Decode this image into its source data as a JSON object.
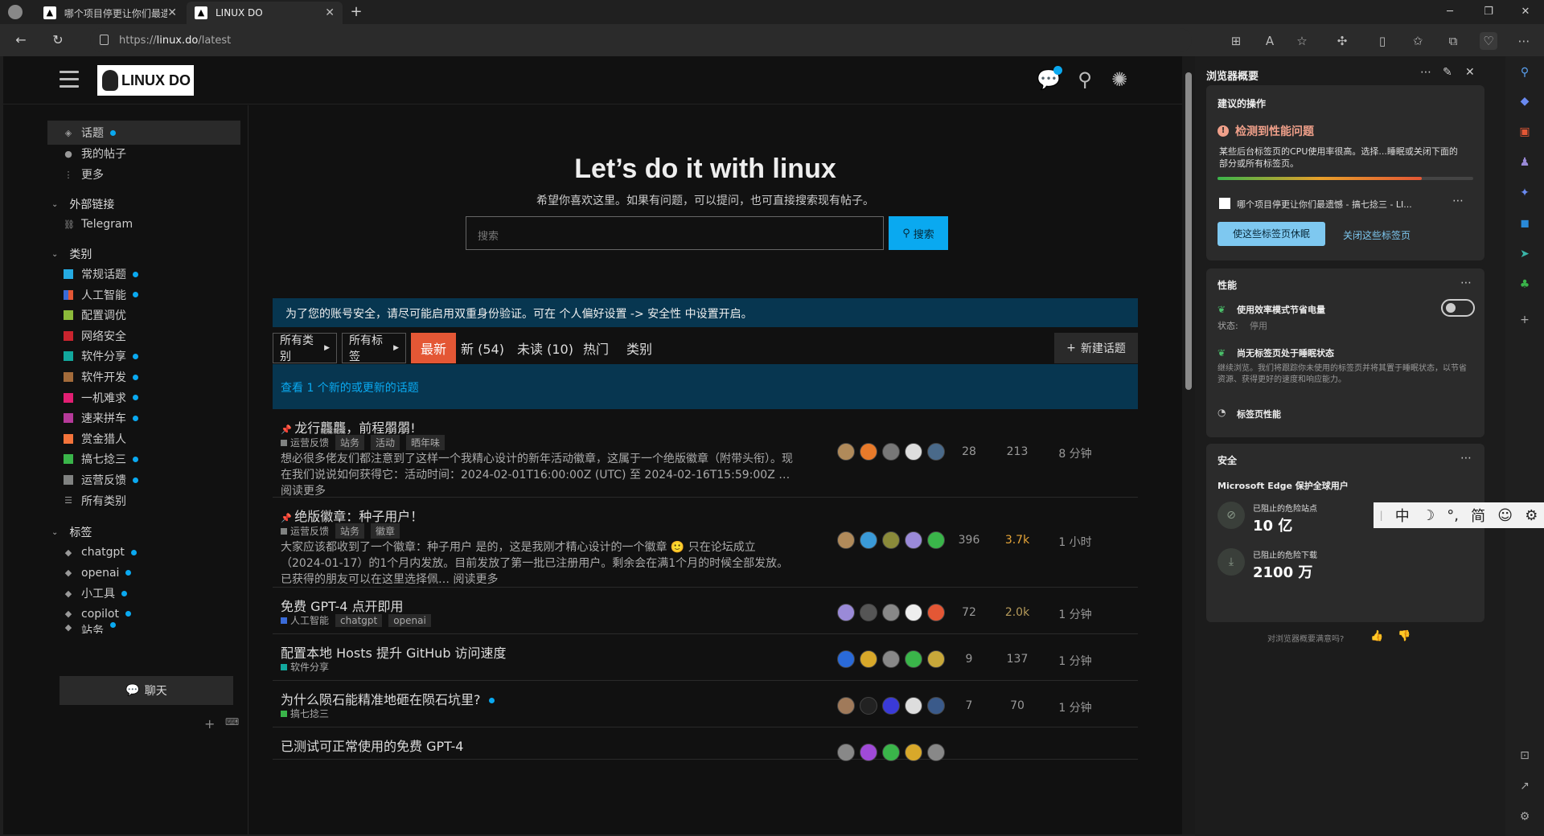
{
  "tabs": [
    {
      "title": "哪个项目停更让你们最遗憾 - 搞..."
    },
    {
      "title": "LINUX DO"
    }
  ],
  "address": {
    "scheme": "https://",
    "host": "linux.do",
    "path": "/latest"
  },
  "site": {
    "logo_text": "LINUX DO"
  },
  "sidebar": {
    "main": [
      {
        "label": "话题",
        "icon": "layers-icon",
        "dot": true
      },
      {
        "label": "我的帖子",
        "icon": "user-icon",
        "dot": false
      },
      {
        "label": "更多",
        "icon": "vertical-dots-icon",
        "dot": false
      }
    ],
    "links_head": "外部链接",
    "links": [
      {
        "label": "Telegram"
      }
    ],
    "categories_head": "类别",
    "categories": [
      {
        "label": "常规话题",
        "color": "#25aae1",
        "dot": true
      },
      {
        "label": "人工智能",
        "color": "#3a6bd8",
        "color2": "#e45735",
        "dot": true
      },
      {
        "label": "配置调优",
        "color": "#8cba3a",
        "dot": false
      },
      {
        "label": "网络安全",
        "color": "#c9242e",
        "dot": false
      },
      {
        "label": "软件分享",
        "color": "#12a89d",
        "dot": true
      },
      {
        "label": "软件开发",
        "color": "#a36b3a",
        "dot": true
      },
      {
        "label": "一机难求",
        "color": "#e21f73",
        "dot": true
      },
      {
        "label": "速来拼车",
        "color": "#b63a9a",
        "dot": true
      },
      {
        "label": "赏金猎人",
        "color": "#f4743b",
        "dot": false
      },
      {
        "label": "搞七捻三",
        "color": "#3ab54a",
        "dot": true
      },
      {
        "label": "运营反馈",
        "color": "#808281",
        "dot": true
      },
      {
        "label": "所有类别",
        "color": "",
        "dot": false
      }
    ],
    "tags_head": "标签",
    "tags": [
      {
        "label": "chatgpt"
      },
      {
        "label": "openai"
      },
      {
        "label": "小工具"
      },
      {
        "label": "copilot"
      },
      {
        "label": "站务"
      }
    ],
    "chat_label": "聊天"
  },
  "banner": {
    "title": "Let’s do it with linux",
    "subtitle": "希望你喜欢这里。如果有问题，可以提问，也可直接搜索现有帖子。",
    "search_placeholder": "搜索",
    "search_button": "搜索"
  },
  "notice": "为了您的账号安全，请尽可能启用双重身份验证。可在 个人偏好设置 -> 安全性 中设置开启。",
  "nav": {
    "all_categories": "所有类别",
    "all_tags": "所有标签",
    "items": [
      "最新",
      "新 (54)",
      "未读 (10)",
      "热门",
      "类别"
    ],
    "new_topic": "新建话题"
  },
  "new_topics_bar": "查看 1 个新的或更新的话题",
  "topics": [
    {
      "title": "龙行龘龘，前程朤朤!",
      "pinned": true,
      "category": "运营反馈",
      "cat_color": "#808281",
      "tags": [
        "站务",
        "活动",
        "晒年味"
      ],
      "excerpt": "想必很多佬友们都注意到了这样一个我精心设计的新年活动徽章，这属于一个绝版徽章（附带头衔）。现在我们说说如何获得它：活动时间：2024-02-01T16:00:00Z (UTC) 至 2024-02-16T15:59:00Z … 阅读更多",
      "replies": "28",
      "views": "213",
      "activity": "8 分钟",
      "avatars": [
        "#b08a5a",
        "#e87a2a",
        "#777",
        "#ddd",
        "#4a6a8a"
      ]
    },
    {
      "title": "绝版徽章：种子用户！",
      "pinned": true,
      "category": "运营反馈",
      "cat_color": "#808281",
      "tags": [
        "站务",
        "徽章"
      ],
      "excerpt": "大家应该都收到了一个徽章：种子用户 是的，这是我刚才精心设计的一个徽章 🙂 只在论坛成立（2024-01-17）的1个月内发放。目前发放了第一批已注册用户。剩余会在满1个月的时候全部发放。已获得的朋友可以在这里选择佩… 阅读更多",
      "replies": "396",
      "views": "3.7k",
      "views_hot": true,
      "activity": "1 小时",
      "avatars": [
        "#b08a5a",
        "#3a9ad8",
        "#8a8a3a",
        "#9a8ad8",
        "#3ab54a"
      ]
    },
    {
      "title": "免费 GPT-4 点开即用",
      "pinned": false,
      "category": "人工智能",
      "cat_color": "#3a6bd8",
      "tags": [
        "chatgpt",
        "openai"
      ],
      "replies": "72",
      "views": "2.0k",
      "views_warm": true,
      "activity": "1 分钟",
      "avatars": [
        "#9a8ad8",
        "#555",
        "#888",
        "#eee",
        "#e45735"
      ]
    },
    {
      "title": "配置本地 Hosts 提升 GitHub 访问速度",
      "pinned": false,
      "category": "软件分享",
      "cat_color": "#12a89d",
      "tags": [],
      "replies": "9",
      "views": "137",
      "activity": "1 分钟",
      "avatars": [
        "#2a6ad8",
        "#d8a82a",
        "#888",
        "#3ab54a",
        "#c8a83a"
      ]
    },
    {
      "title": "为什么陨石能精准地砸在陨石坑里?",
      "pinned": false,
      "category": "搞七捻三",
      "cat_color": "#3ab54a",
      "tags": [],
      "unread_dot": true,
      "replies": "7",
      "views": "70",
      "activity": "1 分钟",
      "avatars": [
        "#a07a5a",
        "#222",
        "#3a3ad8",
        "#ddd",
        "#3a5a8a"
      ]
    },
    {
      "title": "已测试可正常使用的免费 GPT-4",
      "pinned": false,
      "category": "",
      "cat_color": "",
      "tags": [],
      "replies": "",
      "views": "",
      "activity": "",
      "avatars": [
        "#888",
        "#a04ad8",
        "#3ab54a",
        "#d8a82a",
        "#888"
      ]
    }
  ],
  "panel": {
    "title": "浏览器概要",
    "suggested": {
      "head": "建议的操作",
      "issue_title": "检测到性能问题",
      "issue_body": "某些后台标签页的CPU使用率很高。选择...睡眠或关闭下面的部分或所有标签页。",
      "tab_title": "哪个项目停更让你们最遗憾 - 搞七捻三 - LI...",
      "sleep_btn": "使这些标签页休眠",
      "close_link": "关闭这些标签页"
    },
    "performance": {
      "head": "性能",
      "efficiency": "使用效率模式节省电量",
      "status_label": "状态:",
      "status_value": "停用",
      "sleeping": "尚无标签页处于睡眠状态",
      "sleeping_desc": "继续浏览。我们将跟踪你未使用的标签页并将其置于睡眠状态，以节省资源、获得更好的速度和响应能力。",
      "tab_perf": "标签页性能"
    },
    "security": {
      "head": "安全",
      "protect": "Microsoft Edge 保护全球用户",
      "sites_label": "已阻止的危险站点",
      "sites_value": "10 亿",
      "downloads_label": "已阻止的危险下载",
      "downloads_value": "2100 万"
    },
    "feedback": "对浏览器概要满意吗?"
  },
  "ime": {
    "items": [
      "中",
      "☽",
      "°,",
      "简",
      "☺",
      "⚙"
    ]
  }
}
